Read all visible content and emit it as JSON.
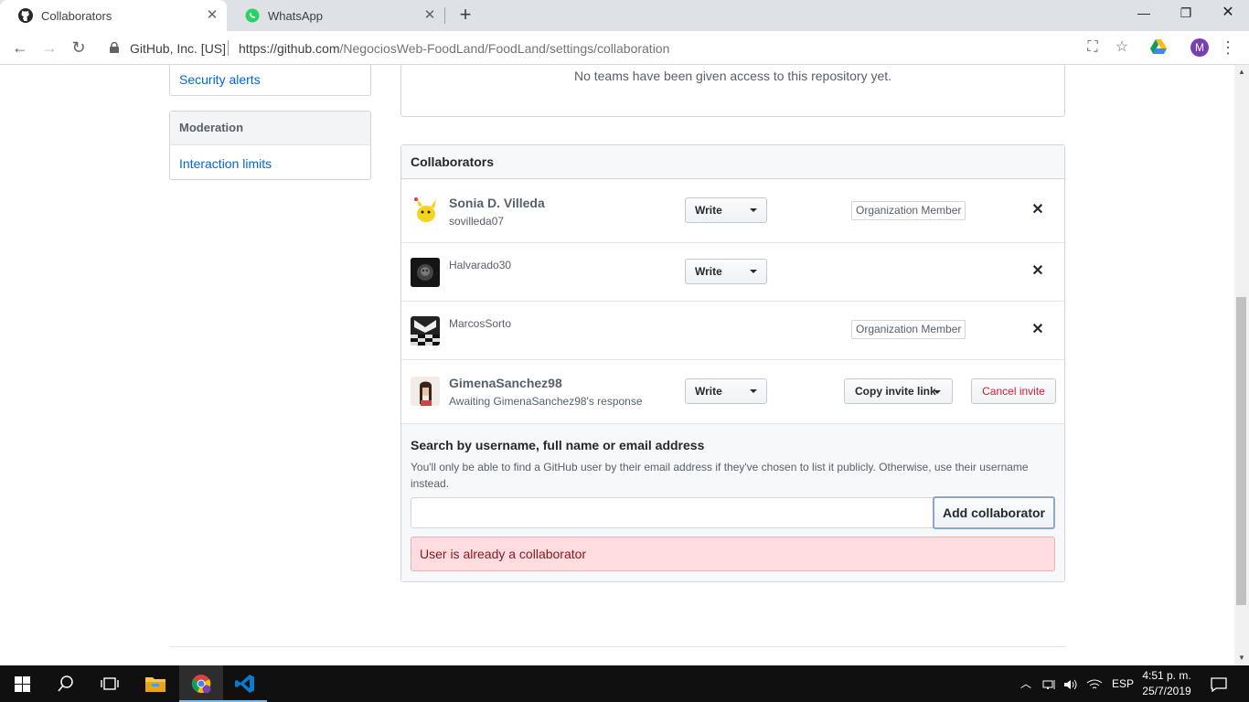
{
  "browser": {
    "tabs": [
      {
        "title": "Collaborators",
        "icon": "github-icon"
      },
      {
        "title": "WhatsApp",
        "icon": "whatsapp-icon"
      }
    ],
    "site_identity": "GitHub, Inc. [US]",
    "url_host": "https://github.com",
    "url_path": "/NegociosWeb-FoodLand/FoodLand/settings/collaboration",
    "profile_initial": "M"
  },
  "sidebar": {
    "security_alerts": "Security alerts",
    "moderation_heading": "Moderation",
    "interaction_limits": "Interaction limits"
  },
  "teams": {
    "empty_text": "No teams have been given access to this repository yet."
  },
  "collaborators": {
    "heading": "Collaborators",
    "rows": [
      {
        "name": "Sonia D. Villeda",
        "login": "sovilleda07",
        "permission": "Write",
        "label": "Organization Member"
      },
      {
        "login": "Halvarado30",
        "permission": "Write"
      },
      {
        "login": "MarcosSorto",
        "label": "Organization Member"
      },
      {
        "name": "GimenaSanchez98",
        "status": "Awaiting GimenaSanchez98's response",
        "permission": "Write",
        "copy_invite": "Copy invite link",
        "cancel_invite": "Cancel invite"
      }
    ],
    "remove_symbol": "✕"
  },
  "add": {
    "title": "Search by username, full name or email address",
    "note": "You'll only be able to find a GitHub user by their email address if they've chosen to list it publicly. Otherwise, use their username instead.",
    "input_value": "",
    "button": "Add collaborator",
    "error": "User is already a collaborator"
  },
  "taskbar": {
    "language": "ESP",
    "time": "4:51 p. m.",
    "date": "25/7/2019"
  }
}
